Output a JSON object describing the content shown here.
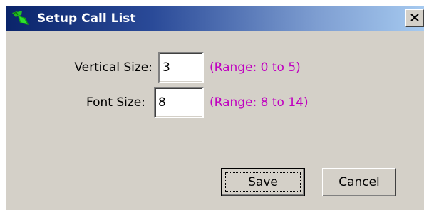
{
  "window": {
    "title": "Setup Call List",
    "icon": "palm-tree-icon",
    "close_icon": "close-icon"
  },
  "fields": {
    "vertical_size": {
      "label": "Vertical Size:",
      "value": "3",
      "range": "(Range: 0 to 5)"
    },
    "font_size": {
      "label": "Font Size:",
      "value": "8",
      "range": "(Range: 8 to 14)"
    }
  },
  "buttons": {
    "save": {
      "mnemonic": "S",
      "rest": "ave"
    },
    "cancel": {
      "mnemonic": "C",
      "rest": "ancel"
    }
  },
  "colors": {
    "title_gradient_start": "#0a246a",
    "title_gradient_end": "#a6caf0",
    "dialog_bg": "#d4d0c8",
    "range_text": "#c000c0"
  }
}
